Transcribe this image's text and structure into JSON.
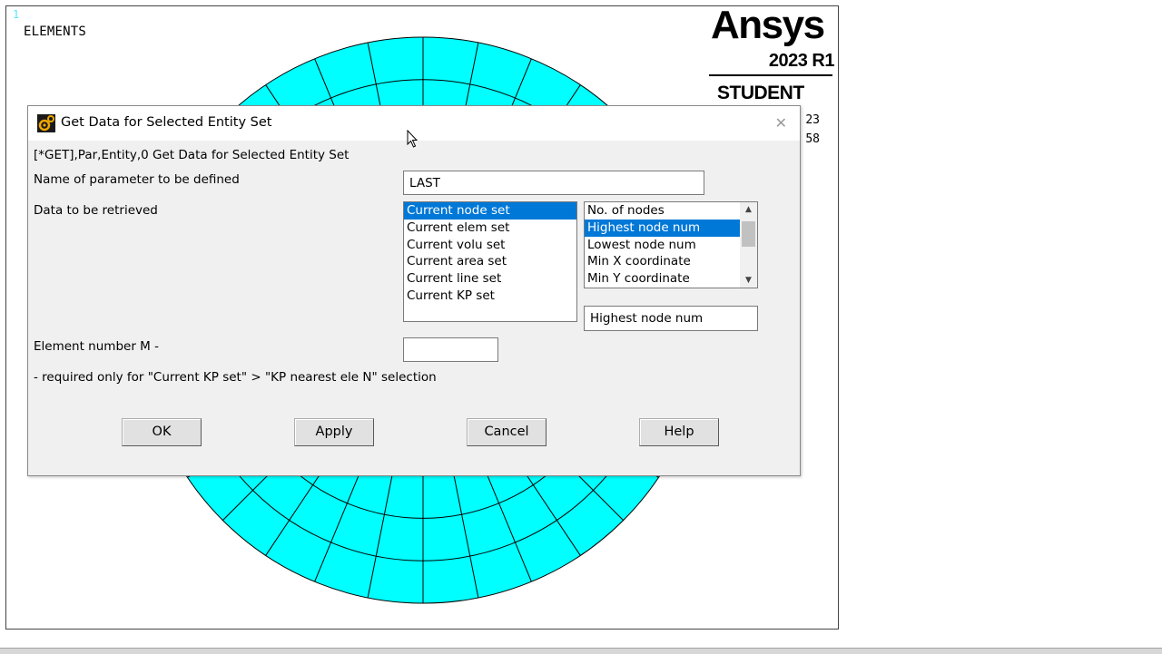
{
  "graphics": {
    "window_number": "1",
    "plot_label": "ELEMENTS",
    "logo": {
      "brand": "Ansys",
      "version": "2023 R1",
      "edition": "STUDENT"
    },
    "info_lines": [
      "23",
      "58"
    ],
    "mesh_color": "#00ffff"
  },
  "dialog": {
    "title": "Get Data for Selected Entity Set",
    "command": "[*GET],Par,Entity,0   Get Data for Selected Entity Set",
    "param_label": "Name of parameter to be defined",
    "param_value": "LAST",
    "data_label": "Data to be retrieved",
    "entity_list": [
      "Current node set",
      "Current elem set",
      "Current volu set",
      "Current area set",
      "Current line set",
      "Current KP set"
    ],
    "entity_selected": "Current node set",
    "item_list": [
      "No. of nodes",
      "Highest node num",
      "Lowest node num",
      "Min X coordinate",
      "Min Y coordinate"
    ],
    "item_selected": "Highest node num",
    "item_value": "Highest node num",
    "element_label": "Element number M -",
    "element_value": "",
    "note": "- required only for \"Current KP set\" > \"KP nearest ele N\" selection",
    "buttons": {
      "ok": "OK",
      "apply": "Apply",
      "cancel": "Cancel",
      "help": "Help"
    }
  }
}
